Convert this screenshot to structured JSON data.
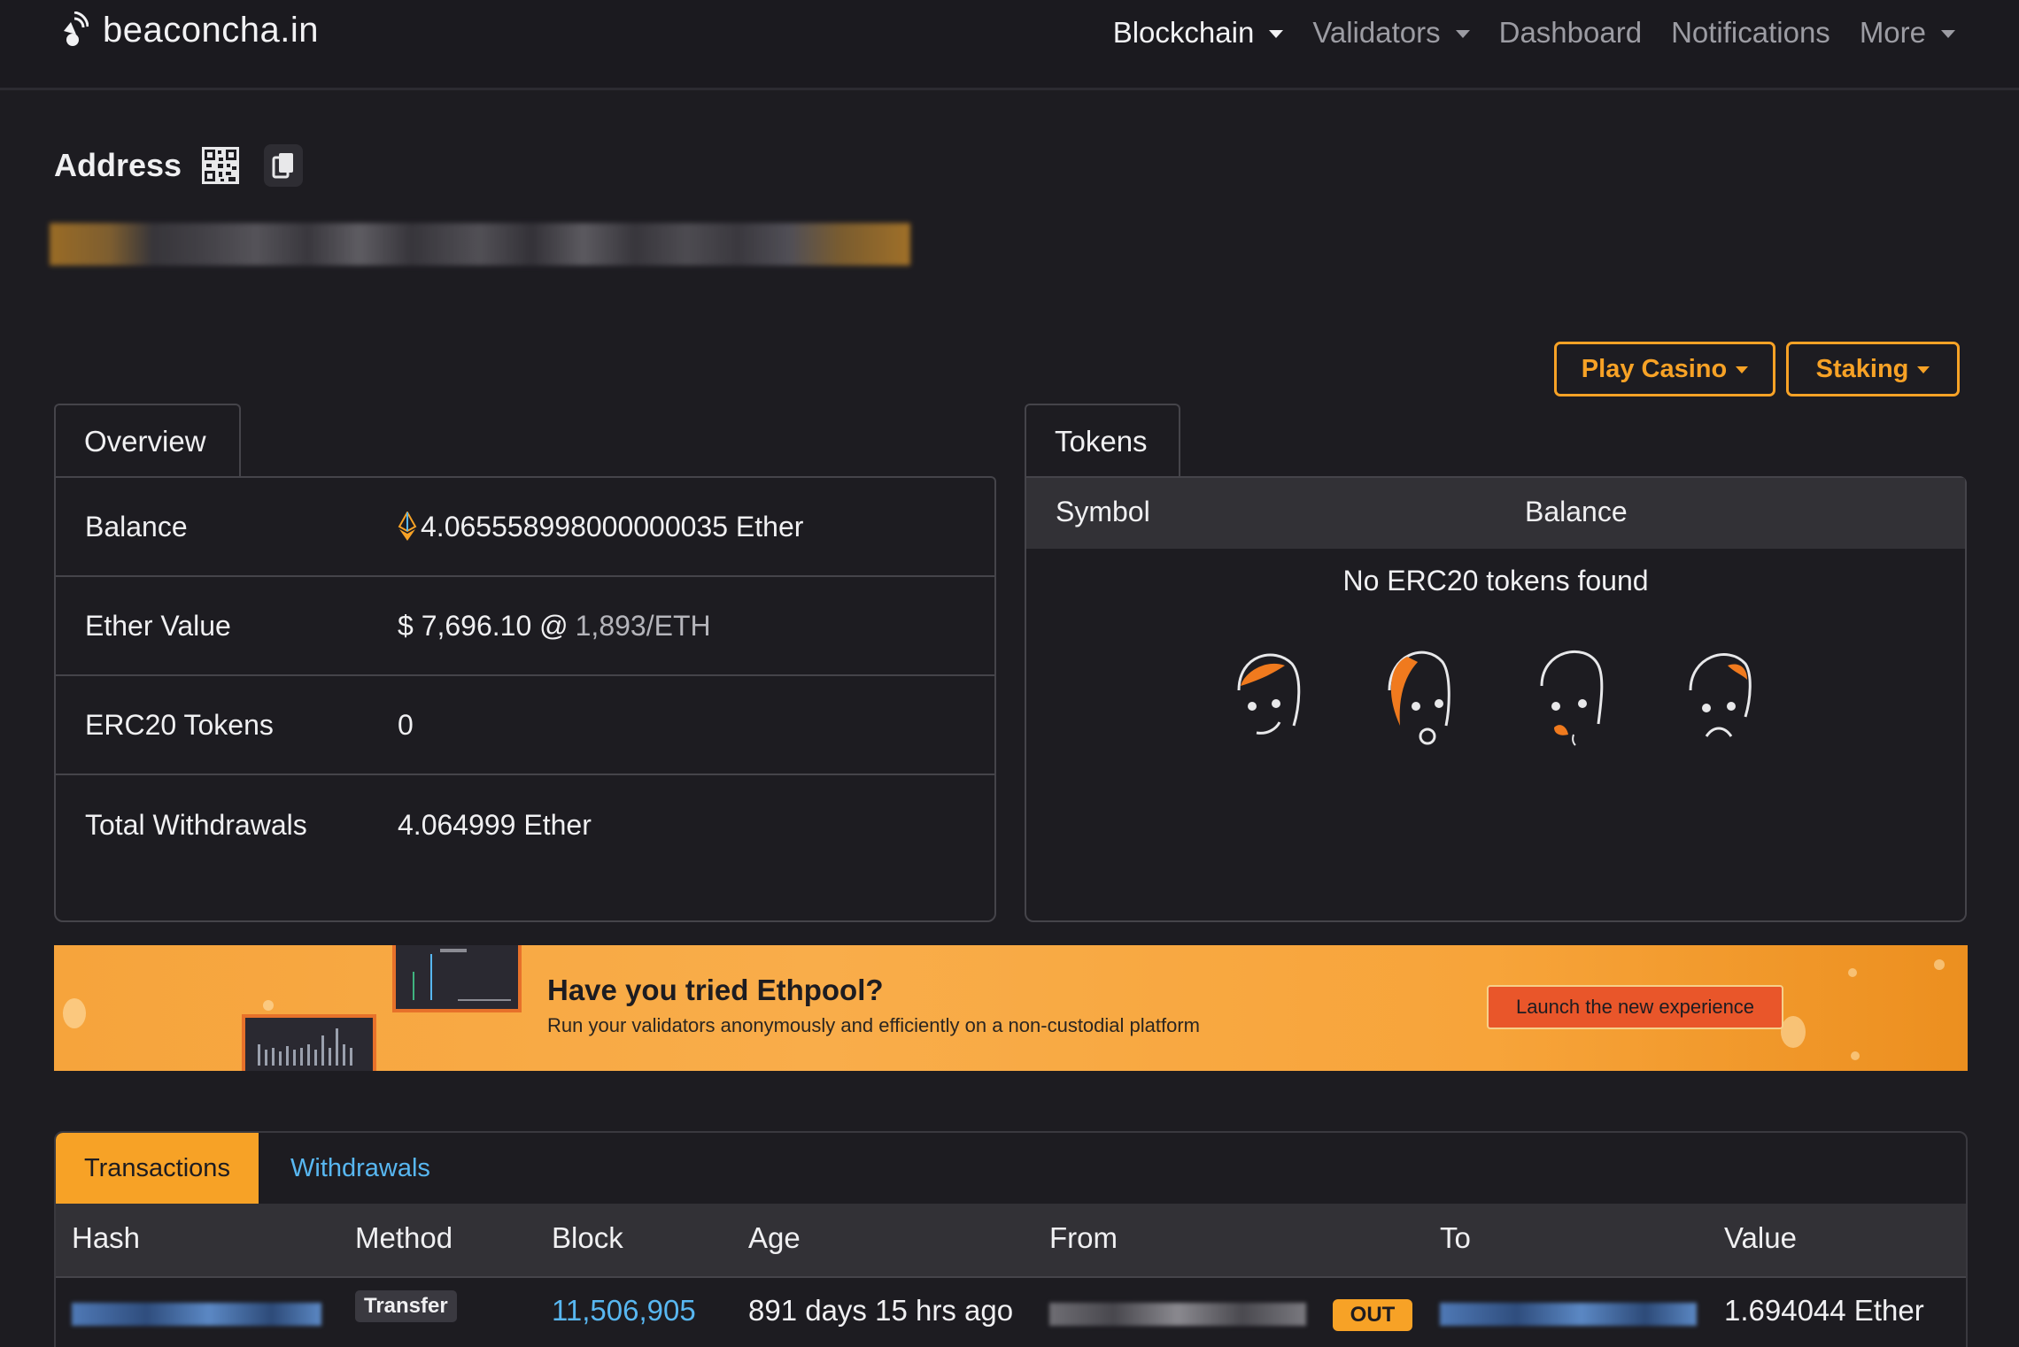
{
  "navbar": {
    "brand": "beaconcha.in",
    "items": [
      {
        "label": "Blockchain",
        "dropdown": true,
        "active": true
      },
      {
        "label": "Validators",
        "dropdown": true,
        "active": false
      },
      {
        "label": "Dashboard",
        "dropdown": false,
        "active": false
      },
      {
        "label": "Notifications",
        "dropdown": false,
        "active": false
      },
      {
        "label": "More",
        "dropdown": true,
        "active": false
      }
    ]
  },
  "address": {
    "title": "Address",
    "qr_icon": "qr-code-icon",
    "copy_icon": "copy-icon"
  },
  "actions": {
    "casino": "Play Casino",
    "staking": "Staking"
  },
  "overview": {
    "tab": "Overview",
    "rows": [
      {
        "label": "Balance",
        "value": "4.065558998000000035 Ether"
      },
      {
        "label": "Ether Value",
        "value": "$ 7,696.10 @",
        "extra": "1,893/ETH"
      },
      {
        "label": "ERC20 Tokens",
        "value": "0"
      },
      {
        "label": "Total Withdrawals",
        "value": "4.064999 Ether"
      }
    ]
  },
  "tokens": {
    "tab": "Tokens",
    "col_symbol": "Symbol",
    "col_balance": "Balance",
    "empty": "No ERC20 tokens found"
  },
  "banner": {
    "title": "Have you tried Ethpool?",
    "subtitle": "Run your validators anonymously and efficiently on a non-custodial platform",
    "button": "Launch the new experience"
  },
  "transactions": {
    "tabs": [
      "Transactions",
      "Withdrawals"
    ],
    "columns": [
      "Hash",
      "Method",
      "Block",
      "Age",
      "From",
      "To",
      "Value"
    ],
    "rows": [
      {
        "method": "Transfer",
        "block": "11,506,905",
        "age": "891 days 15 hrs ago",
        "direction": "OUT",
        "value": "1.694044 Ether"
      }
    ]
  },
  "colors": {
    "accent": "#f7a226",
    "link": "#58b7f1",
    "background": "#1d1c21",
    "border": "#45444a"
  }
}
